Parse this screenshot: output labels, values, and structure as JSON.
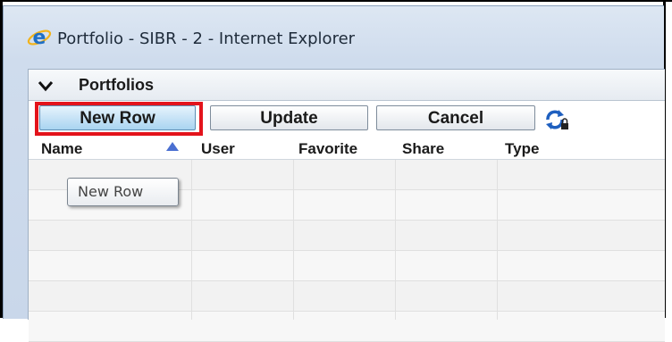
{
  "window": {
    "title": "Portfolio - SIBR - 2 - Internet Explorer",
    "icon": "internet-explorer-icon"
  },
  "panel": {
    "title": "Portfolios",
    "collapse_icon": "chevron-down-icon"
  },
  "toolbar": {
    "new_row_label": "New Row",
    "update_label": "Update",
    "cancel_label": "Cancel",
    "refresh_icon": "refresh-lock-icon",
    "highlight_color": "#e3131b"
  },
  "grid": {
    "columns": [
      "Name",
      "User",
      "Favorite",
      "Share",
      "Type"
    ],
    "sort_column": "Name",
    "sort_direction": "ascending",
    "rows": []
  },
  "tooltip": {
    "text": "New Row"
  }
}
